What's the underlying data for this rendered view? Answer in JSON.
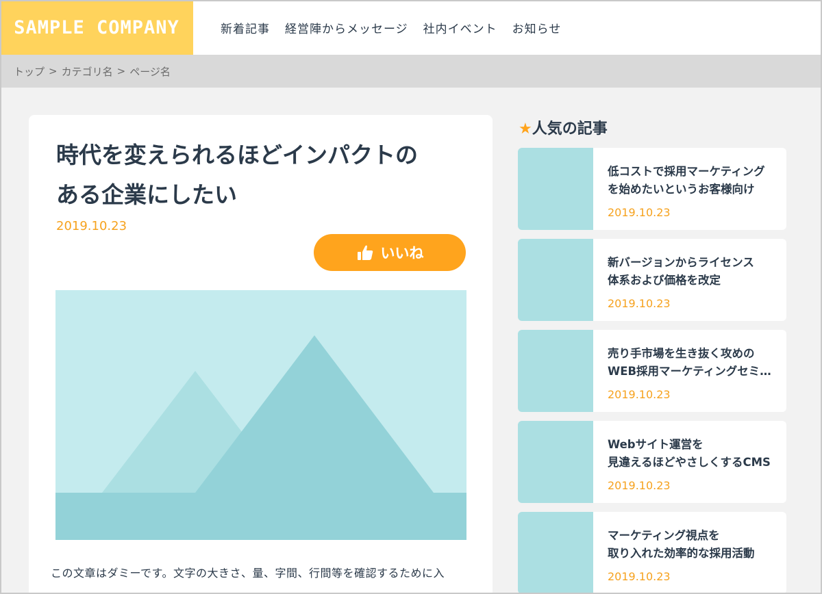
{
  "header": {
    "logo": "SAMPLE COMPANY",
    "nav": [
      "新着記事",
      "経営陣からメッセージ",
      "社内イベント",
      "お知らせ"
    ]
  },
  "breadcrumb": {
    "items": [
      "トップ",
      "カテゴリ名",
      "ページ名"
    ],
    "separator": ">"
  },
  "article": {
    "title_line1": "時代を変えられるほどインパクトの",
    "title_line2": "ある企業にしたい",
    "date": "2019.10.23",
    "like_label": "いいね",
    "body": "この文章はダミーです。文字の大きさ、量、字間、行間等を確認するために入"
  },
  "sidebar": {
    "star": "★",
    "title": "人気の記事",
    "items": [
      {
        "line1": "低コストで採用マーケティング",
        "line2": "を始めたいというお客様向け",
        "date": "2019.10.23"
      },
      {
        "line1": "新バージョンからライセンス",
        "line2": "体系および価格を改定",
        "date": "2019.10.23"
      },
      {
        "line1": "売り手市場を生き抜く攻めの",
        "line2": "WEB採用マーケティングセミ…",
        "date": "2019.10.23"
      },
      {
        "line1": "Webサイト運営を",
        "line2": "見違えるほどやさしくするCMS",
        "date": "2019.10.23"
      },
      {
        "line1": "マーケティング視点を",
        "line2": "取り入れた効率的な採用活動",
        "date": "2019.10.23"
      }
    ]
  },
  "colors": {
    "accent": "#ffa41d",
    "logo_bg": "#ffd35c",
    "text": "#2b3a4a",
    "thumb": "#abdfe2"
  }
}
